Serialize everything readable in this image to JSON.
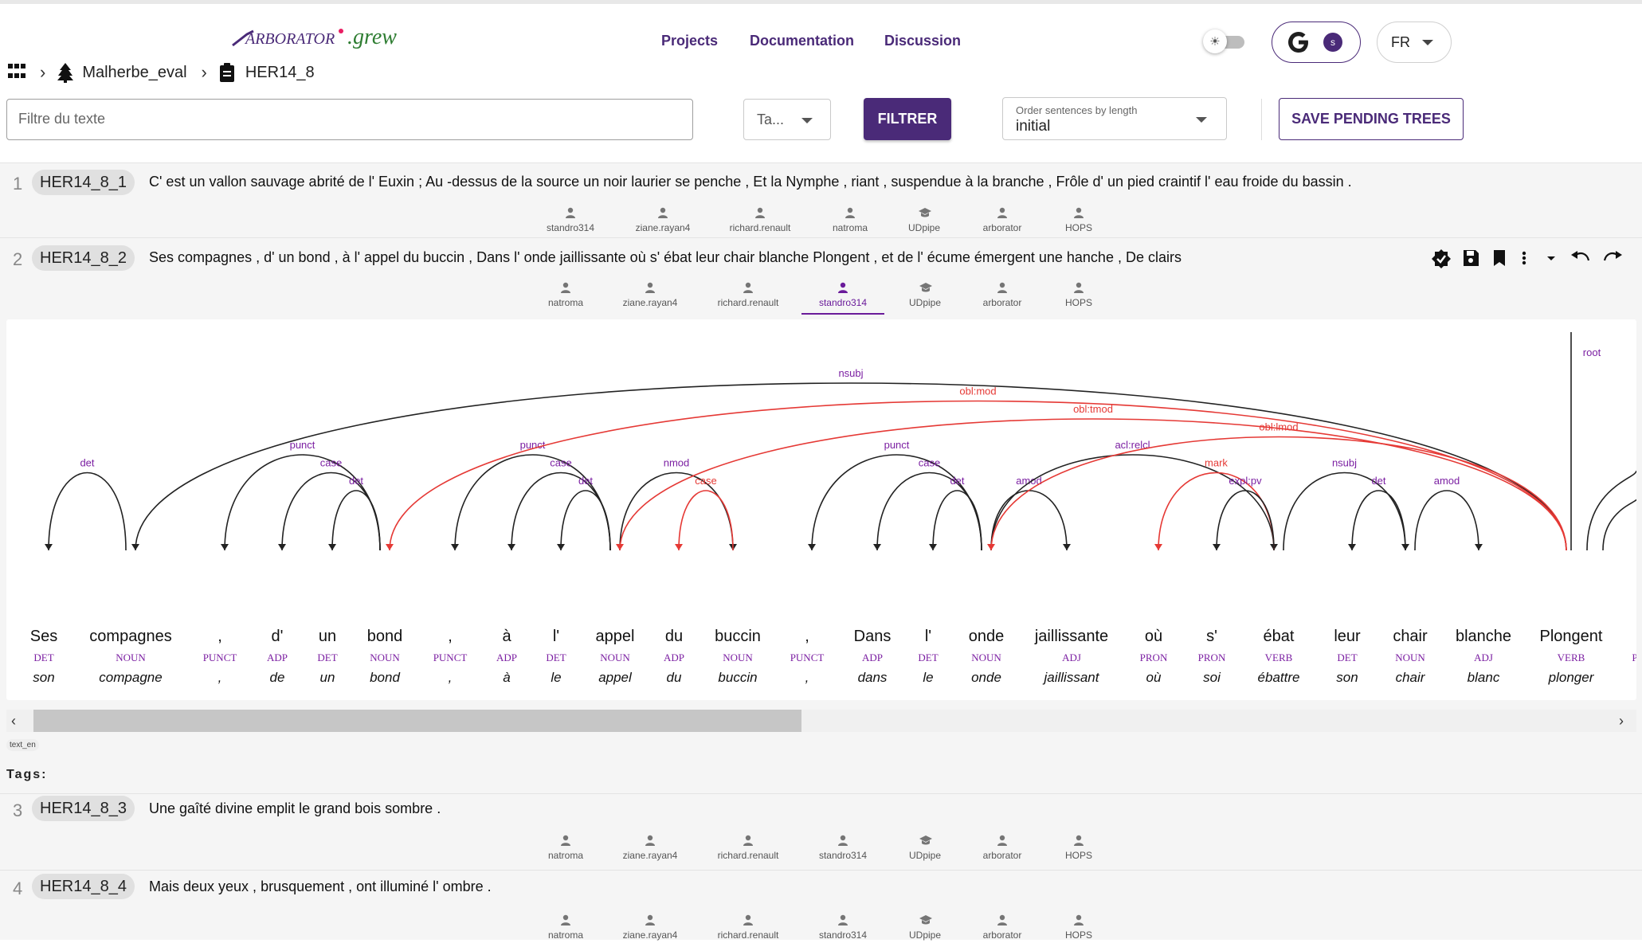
{
  "header": {
    "logo_text": "ArboratorGrew",
    "nav": {
      "projects": "Projects",
      "documentation": "Documentation",
      "discussion": "Discussion"
    },
    "user_initial": "s",
    "language": "FR"
  },
  "breadcrumb": {
    "project": "Malherbe_eval",
    "sample": "HER14_8"
  },
  "filters": {
    "text_placeholder": "Filtre du texte",
    "tag_select": "Ta...",
    "filter_button": "FILTRER",
    "order_label": "Order sentences by length",
    "order_value": "initial",
    "save_button": "SAVE PENDING TREES"
  },
  "sentences": [
    {
      "num": "1",
      "id": "HER14_8_1",
      "text": "C' est un vallon sauvage abrité de l' Euxin ; Au -dessus de la source un noir laurier se penche , Et la Nymphe , riant , suspendue à la branche , Frôle d' un pied craintif l' eau froide du bassin .",
      "tabs": [
        "standro314",
        "ziane.rayan4",
        "richard.renault",
        "natroma",
        "UDpipe",
        "arborator",
        "HOPS"
      ]
    },
    {
      "num": "2",
      "id": "HER14_8_2",
      "text": "Ses compagnes , d' un bond , à l' appel du buccin , Dans l' onde jaillissante où s' ébat leur chair blanche Plongent , et de l' écume émergent une hanche , De clairs",
      "tabs": [
        "natroma",
        "ziane.rayan4",
        "richard.renault",
        "standro314",
        "UDpipe",
        "arborator",
        "HOPS"
      ]
    },
    {
      "num": "3",
      "id": "HER14_8_3",
      "text": "Une gaîté divine emplit le grand bois sombre .",
      "tabs": [
        "natroma",
        "ziane.rayan4",
        "richard.renault",
        "standro314",
        "UDpipe",
        "arborator",
        "HOPS"
      ]
    },
    {
      "num": "4",
      "id": "HER14_8_4",
      "text": "Mais deux yeux , brusquement , ont illuminé l' ombre .",
      "tabs": [
        "natroma",
        "ziane.rayan4",
        "richard.renault",
        "standro314",
        "UDpipe",
        "arborator",
        "HOPS"
      ]
    }
  ],
  "tree": {
    "tokens": [
      {
        "form": "Ses",
        "upos": "DET",
        "lemma": "son"
      },
      {
        "form": "compagnes",
        "upos": "NOUN",
        "lemma": "compagne"
      },
      {
        "form": ",",
        "upos": "PUNCT",
        "lemma": ","
      },
      {
        "form": "d'",
        "upos": "ADP",
        "lemma": "de"
      },
      {
        "form": "un",
        "upos": "DET",
        "lemma": "un"
      },
      {
        "form": "bond",
        "upos": "NOUN",
        "lemma": "bond"
      },
      {
        "form": ",",
        "upos": "PUNCT",
        "lemma": ","
      },
      {
        "form": "à",
        "upos": "ADP",
        "lemma": "à"
      },
      {
        "form": "l'",
        "upos": "DET",
        "lemma": "le"
      },
      {
        "form": "appel",
        "upos": "NOUN",
        "lemma": "appel"
      },
      {
        "form": "du",
        "upos": "ADP",
        "lemma": "du"
      },
      {
        "form": "buccin",
        "upos": "NOUN",
        "lemma": "buccin"
      },
      {
        "form": ",",
        "upos": "PUNCT",
        "lemma": ","
      },
      {
        "form": "Dans",
        "upos": "ADP",
        "lemma": "dans"
      },
      {
        "form": "l'",
        "upos": "DET",
        "lemma": "le"
      },
      {
        "form": "onde",
        "upos": "NOUN",
        "lemma": "onde"
      },
      {
        "form": "jaillissante",
        "upos": "ADJ",
        "lemma": "jaillissant"
      },
      {
        "form": "où",
        "upos": "PRON",
        "lemma": "où"
      },
      {
        "form": "s'",
        "upos": "PRON",
        "lemma": "soi"
      },
      {
        "form": "ébat",
        "upos": "VERB",
        "lemma": "ébattre"
      },
      {
        "form": "leur",
        "upos": "DET",
        "lemma": "son"
      },
      {
        "form": "chair",
        "upos": "NOUN",
        "lemma": "chair"
      },
      {
        "form": "blanche",
        "upos": "ADJ",
        "lemma": "blanc"
      },
      {
        "form": "Plongent",
        "upos": "VERB",
        "lemma": "plonger"
      }
    ],
    "edges": [
      {
        "h": 1,
        "d": 0,
        "label": "det"
      },
      {
        "h": 5,
        "d": 2,
        "label": "punct"
      },
      {
        "h": 5,
        "d": 3,
        "label": "case"
      },
      {
        "h": 5,
        "d": 4,
        "label": "det"
      },
      {
        "h": 9,
        "d": 6,
        "label": "punct"
      },
      {
        "h": 9,
        "d": 7,
        "label": "case"
      },
      {
        "h": 9,
        "d": 8,
        "label": "det"
      },
      {
        "h": 9,
        "d": 11,
        "label": "nmod"
      },
      {
        "h": 11,
        "d": 10,
        "label": "case",
        "red": true
      },
      {
        "h": 15,
        "d": 12,
        "label": "punct"
      },
      {
        "h": 15,
        "d": 13,
        "label": "case"
      },
      {
        "h": 15,
        "d": 14,
        "label": "det"
      },
      {
        "h": 15,
        "d": 16,
        "label": "amod"
      },
      {
        "h": 15,
        "d": 19,
        "label": "acl:relcl"
      },
      {
        "h": 19,
        "d": 17,
        "label": "mark",
        "red": true
      },
      {
        "h": 19,
        "d": 18,
        "label": "expl:pv"
      },
      {
        "h": 19,
        "d": 21,
        "label": "nsubj"
      },
      {
        "h": 21,
        "d": 20,
        "label": "det"
      },
      {
        "h": 21,
        "d": 22,
        "label": "amod"
      },
      {
        "h": 23,
        "d": 1,
        "label": "nsubj"
      },
      {
        "h": 23,
        "d": 5,
        "label": "obl:mod",
        "red": true
      },
      {
        "h": 23,
        "d": 9,
        "label": "obl:tmod",
        "red": true
      },
      {
        "h": 23,
        "d": 15,
        "label": "obl:lmod",
        "red": true
      }
    ],
    "root_label": "root",
    "partial_token_pos": "P"
  },
  "tree_footer": {
    "text_en_badge": "text_en",
    "tags_label": "Tags:"
  },
  "colors": {
    "brand": "#4a2a78",
    "arc_red": "#e53935",
    "label_purple": "#7b1fa2"
  }
}
